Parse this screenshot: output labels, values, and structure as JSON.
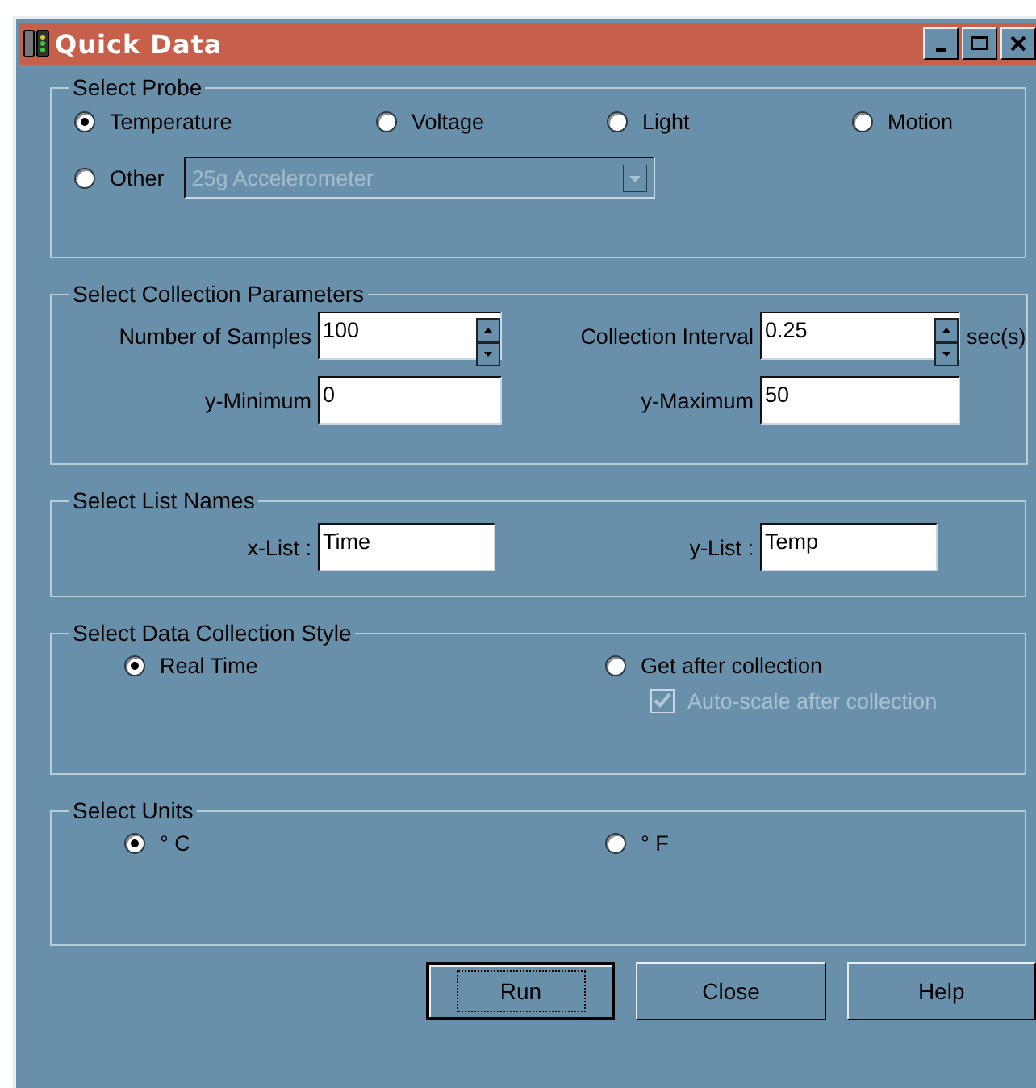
{
  "window": {
    "title": "Quick Data"
  },
  "probe": {
    "legend": "Select Probe",
    "options": [
      {
        "label": "Temperature",
        "selected": true
      },
      {
        "label": "Voltage",
        "selected": false
      },
      {
        "label": "Light",
        "selected": false
      },
      {
        "label": "Motion",
        "selected": false
      }
    ],
    "other": {
      "label": "Other",
      "selected": false,
      "dropdown_value": "25g Accelerometer",
      "disabled": true
    }
  },
  "parameters": {
    "legend": "Select Collection Parameters",
    "fields": [
      {
        "label": "Number of Samples",
        "value": "100",
        "kind": "spin"
      },
      {
        "label": "Collection Interval",
        "value": "0.25",
        "kind": "spin",
        "unit": "sec(s)"
      },
      {
        "label": "y-Minimum",
        "value": "0",
        "kind": "text"
      },
      {
        "label": "y-Maximum",
        "value": "50",
        "kind": "text"
      }
    ]
  },
  "lists": {
    "legend": "Select List Names",
    "fields": [
      {
        "label": "x-List :",
        "value": "Time"
      },
      {
        "label": "y-List :",
        "value": "Temp"
      }
    ]
  },
  "style": {
    "legend": "Select Data Collection Style",
    "options": [
      {
        "label": "Real Time",
        "selected": true
      },
      {
        "label": "Get after collection",
        "selected": false
      }
    ],
    "autoscale": {
      "label": "Auto-scale after collection",
      "checked": true,
      "disabled": true
    }
  },
  "units": {
    "legend": "Select Units",
    "options": [
      {
        "label": "° C",
        "selected": true
      },
      {
        "label": "° F",
        "selected": false
      }
    ]
  },
  "buttons": [
    {
      "label": "Run",
      "focused": true
    },
    {
      "label": "Close",
      "focused": false
    },
    {
      "label": "Help",
      "focused": false
    }
  ]
}
